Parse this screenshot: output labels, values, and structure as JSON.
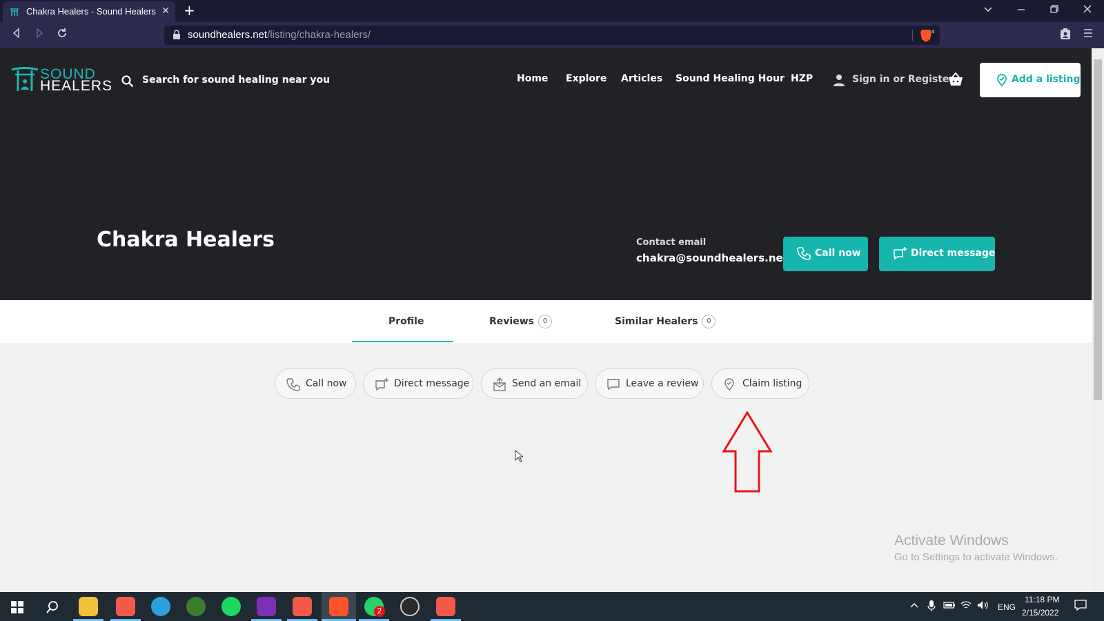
{
  "browser": {
    "tab_title": "Chakra Healers - Sound Healers",
    "tab_close": "✕",
    "new_tab": "+",
    "url_domain": "soundhealers.net",
    "url_path": "/listing/chakra-healers/",
    "shield_count": "4"
  },
  "site": {
    "logo_line1": "SOUND",
    "logo_line2": "HEALERS",
    "search_placeholder": "Search for sound healing near you",
    "nav": [
      "Home",
      "Explore",
      "Articles",
      "Sound Healing Hour",
      "HZP"
    ],
    "signin": "Sign in or Register",
    "add_listing": "Add a listing"
  },
  "listing": {
    "title": "Chakra Healers",
    "contact_label": "Contact email",
    "contact_email": "chakra@soundhealers.net",
    "call_now": "Call now",
    "direct_message": "Direct message"
  },
  "tabs": [
    {
      "label": "Profile"
    },
    {
      "label": "Reviews",
      "count": "0"
    },
    {
      "label": "Similar Healers",
      "count": "0"
    }
  ],
  "actions": [
    "Call now",
    "Direct message",
    "Send an email",
    "Leave a review",
    "Claim listing"
  ],
  "watermark": {
    "line1": "Activate Windows",
    "line2": "Go to Settings to activate Windows."
  },
  "taskbar": {
    "lang": "ENG",
    "time": "11:18 PM",
    "date": "2/15/2022",
    "whatsapp_badge": "2",
    "app_icons": [
      "windows-start-icon",
      "search-icon",
      "file-explorer-icon",
      "brave-profile-icon",
      "telegram-icon",
      "xbox-icon",
      "spotify-icon",
      "onenote-icon",
      "brave-profile-icon",
      "brave-icon",
      "whatsapp-icon",
      "obs-icon",
      "brave-profile-icon"
    ]
  },
  "colors": {
    "accent": "#16b5ad",
    "header_bg": "#212226",
    "annotation_arrow": "#e8151b"
  }
}
